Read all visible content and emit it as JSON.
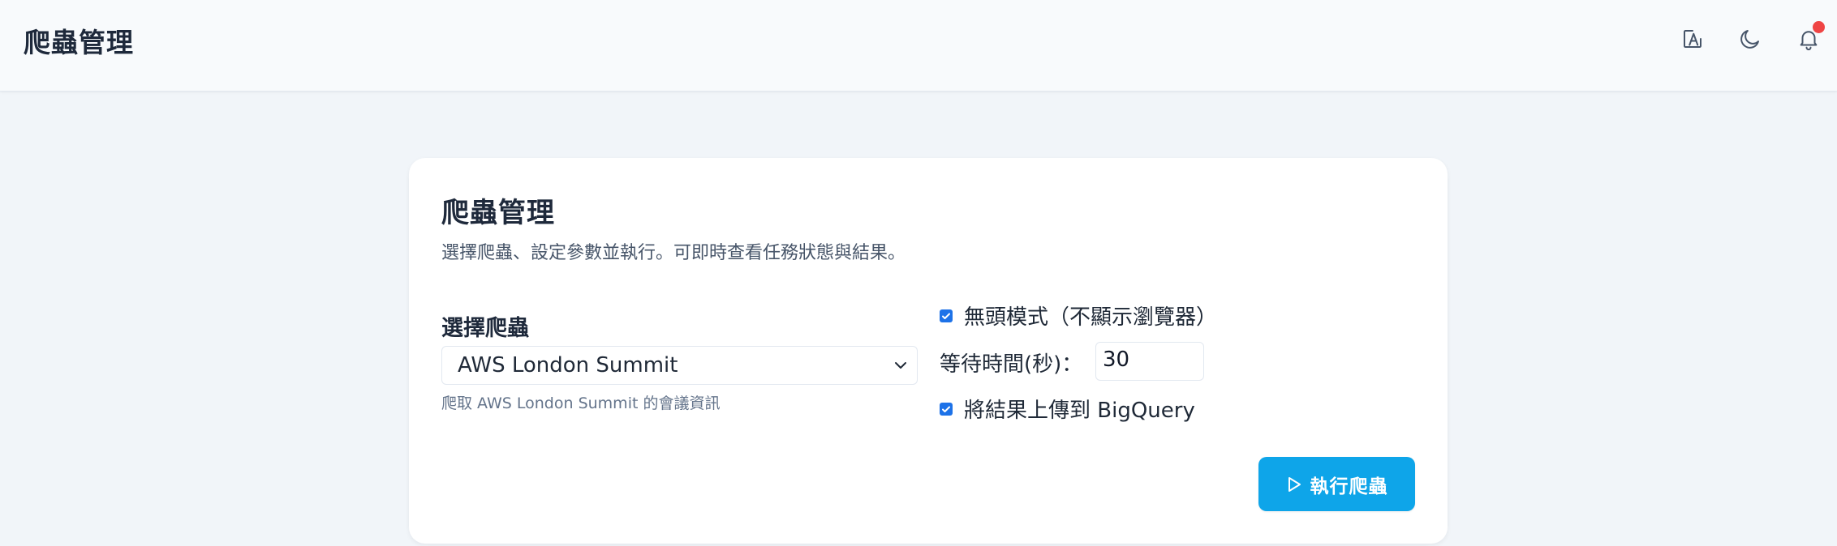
{
  "header": {
    "title": "爬蟲管理",
    "icons": [
      "edit-icon",
      "moon-icon",
      "bell-icon"
    ],
    "notification_dot_color": "#ef4444"
  },
  "card": {
    "title": "爬蟲管理",
    "description": "選擇爬蟲、設定參數並執行。可即時查看任務狀態與結果。",
    "crawler_select": {
      "label": "選擇爬蟲",
      "selected_value": "AWS London Summit",
      "help_text": "爬取 AWS London Summit 的會議資訊"
    },
    "options": {
      "headless": {
        "label": "無頭模式（不顯示瀏覽器）",
        "checked": true
      },
      "wait_time": {
        "label": "等待時間(秒)：",
        "value": "30"
      },
      "upload_bigquery": {
        "label": "將結果上傳到 BigQuery",
        "checked": true
      }
    },
    "run_button": {
      "label": "執行爬蟲",
      "icon": "play-icon",
      "color": "#0ea5e9"
    }
  }
}
